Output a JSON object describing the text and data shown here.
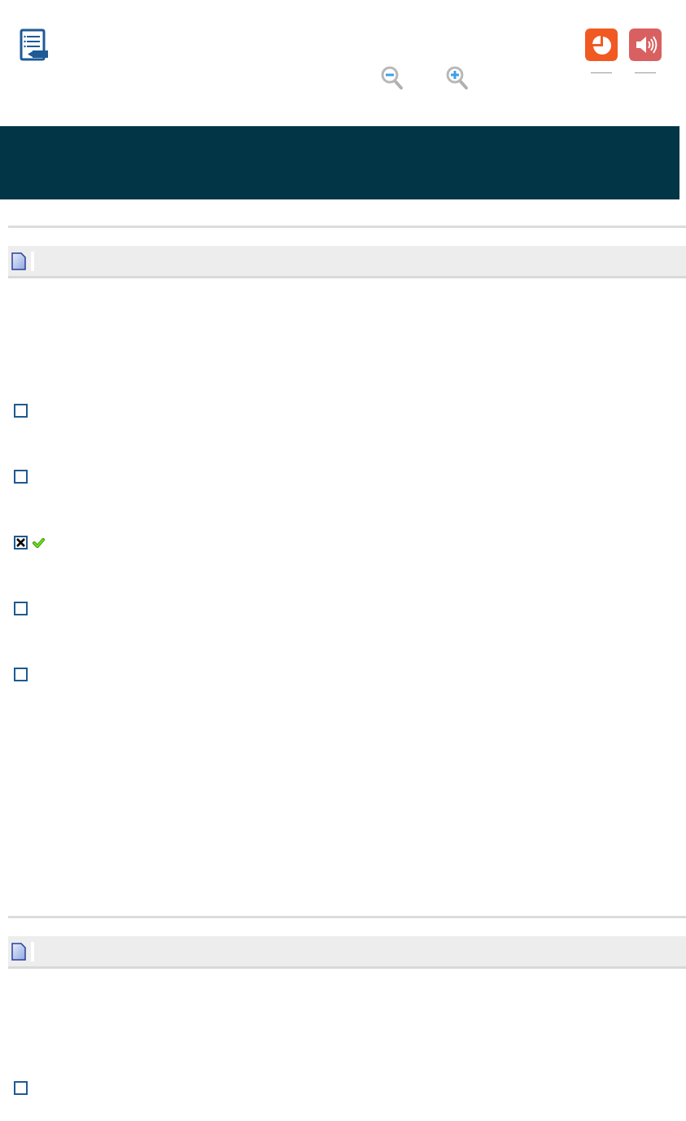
{
  "sections": [
    {
      "options": [
        {
          "checked": false,
          "correct": false
        },
        {
          "checked": false,
          "correct": false
        },
        {
          "checked": true,
          "correct": true
        },
        {
          "checked": false,
          "correct": false
        },
        {
          "checked": false,
          "correct": false
        }
      ]
    },
    {
      "options": [
        {
          "checked": false,
          "correct": false
        }
      ]
    }
  ]
}
